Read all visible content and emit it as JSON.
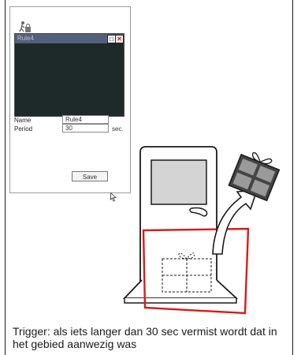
{
  "rule_window": {
    "title": "Rule4"
  },
  "form": {
    "name_label": "Name",
    "name_value": "Rule4",
    "period_label": "Period",
    "period_value": "30",
    "period_unit": "sec.",
    "save_label": "Save"
  },
  "caption": {
    "text": "Trigger: als iets langer dan 30 sec vermist wordt dat in het gebied aanwezig was"
  },
  "colors": {
    "window_bg": "#1e2a2a",
    "title_bar": "#52607a",
    "zone_outline": "#d81b1b"
  },
  "icons": [
    "rule-icon",
    "maximize-icon",
    "close-icon",
    "cursor-icon",
    "gift-icon"
  ]
}
